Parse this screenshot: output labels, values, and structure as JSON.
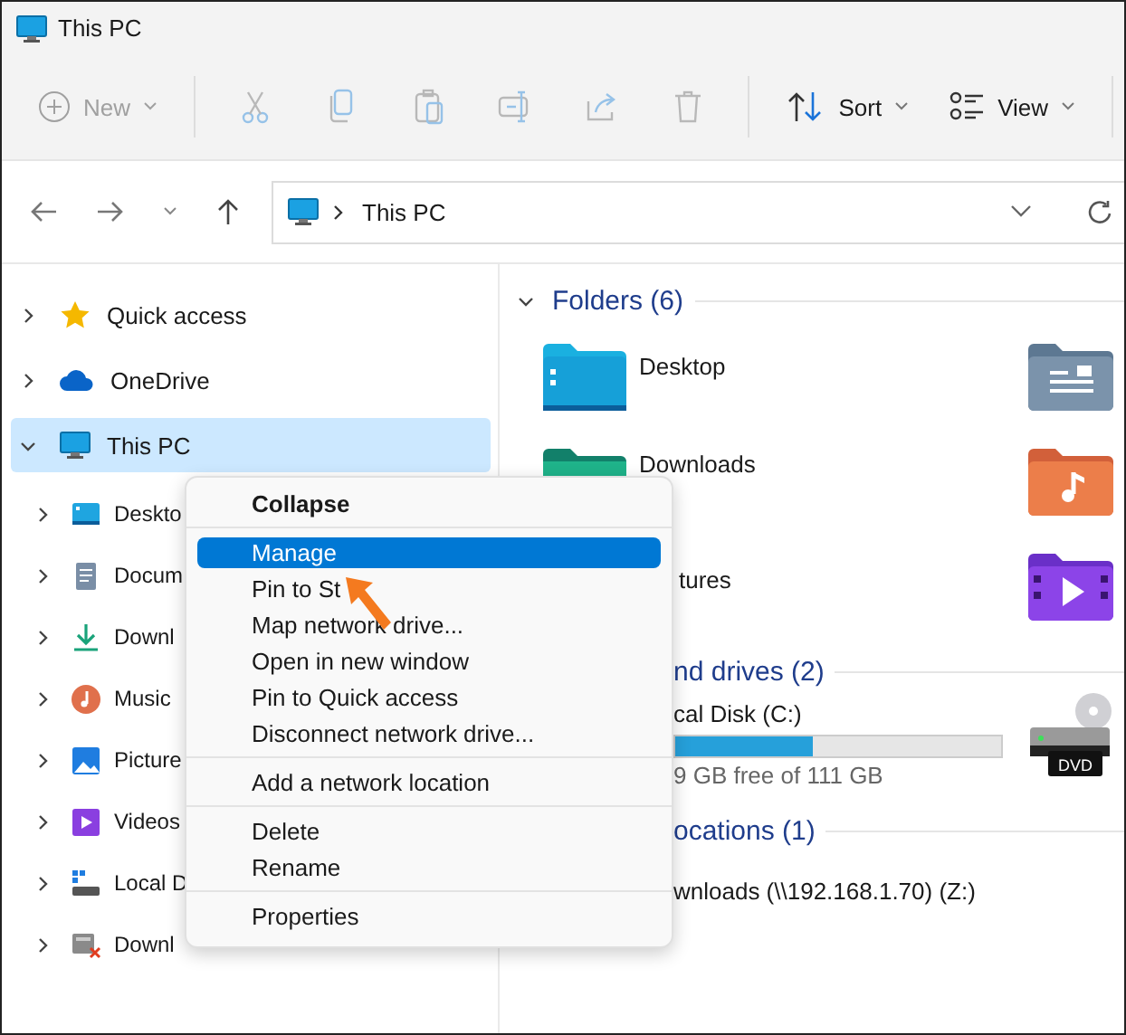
{
  "window": {
    "title": "This PC"
  },
  "toolbar": {
    "new": {
      "label": "New",
      "disabled": true
    },
    "actions": [
      {
        "disabled": true
      },
      {
        "disabled": true
      },
      {
        "disabled": true
      },
      {
        "disabled": true
      },
      {
        "disabled": true
      },
      {
        "disabled": true
      }
    ],
    "sort": {
      "label": "Sort",
      "disabled": false
    },
    "view": {
      "label": "View",
      "disabled": false
    }
  },
  "address": {
    "path": "This PC"
  },
  "sidebar": {
    "items": [
      {
        "label": "Quick access",
        "expanded": false,
        "selected": false
      },
      {
        "label": "OneDrive",
        "expanded": false,
        "selected": false
      },
      {
        "label": "This PC",
        "expanded": true,
        "selected": true,
        "children": [
          {
            "label": "Deskto",
            "expanded": false
          },
          {
            "label": "Docum",
            "expanded": false
          },
          {
            "label": "Downl",
            "expanded": false
          },
          {
            "label": "Music",
            "expanded": false
          },
          {
            "label": "Picture",
            "expanded": false
          },
          {
            "label": "Videos",
            "expanded": false
          },
          {
            "label": "Local D",
            "expanded": false
          },
          {
            "label": "Downl",
            "expanded": false
          }
        ]
      }
    ]
  },
  "folders": {
    "title": "Folders (6)",
    "expanded": true,
    "items": [
      {
        "name": "Desktop"
      },
      {
        "name": "Downloads"
      },
      {
        "name": "tures"
      }
    ]
  },
  "devices": {
    "title": "nd drives (2)",
    "drives": [
      {
        "name": "cal Disk (C:)",
        "level": 0.42,
        "free": "9 GB free of 111 GB"
      }
    ],
    "dvd_label": "DVD"
  },
  "network": {
    "title": "ocations (1)",
    "items": [
      {
        "name": "wnloads (\\\\192.168.1.70) (Z:)"
      }
    ]
  },
  "context_menu": {
    "groups": [
      [
        {
          "label": "Collapse",
          "default": true,
          "selected": false
        }
      ],
      [
        {
          "label": "Manage",
          "default": false,
          "selected": true
        },
        {
          "label": "Pin to St",
          "default": false,
          "selected": false
        },
        {
          "label": "Map network drive...",
          "default": false,
          "selected": false
        },
        {
          "label": "Open in new window",
          "default": false,
          "selected": false
        },
        {
          "label": "Pin to Quick access",
          "default": false,
          "selected": false
        },
        {
          "label": "Disconnect network drive...",
          "default": false,
          "selected": false
        }
      ],
      [
        {
          "label": "Add a network location",
          "default": false,
          "selected": false
        }
      ],
      [
        {
          "label": "Delete",
          "default": false,
          "selected": false
        },
        {
          "label": "Rename",
          "default": false,
          "selected": false
        }
      ],
      [
        {
          "label": "Properties",
          "default": false,
          "selected": false
        }
      ]
    ]
  }
}
